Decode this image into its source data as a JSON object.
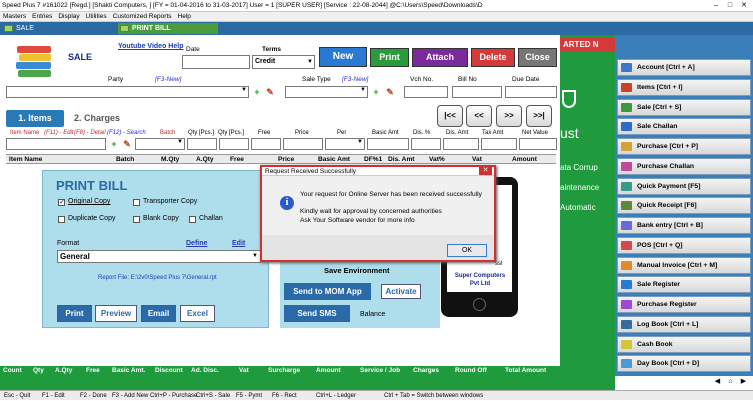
{
  "title": "Speed Plus 7 #161022  [Regd.]  [Shakti Computers, ]  [FY = 01-04-2016 to 31-03-2017]  User = 1 [SUPER USER]  [Service : 22-08-2044]  @C:\\Users\\Speed\\Downloads\\D",
  "menu": [
    "Masters",
    "Entries",
    "Display",
    "Utilities",
    "Customized Reports",
    "Help"
  ],
  "tabs": [
    {
      "label": "SALE"
    },
    {
      "label": "PRINT BILL"
    }
  ],
  "form": {
    "sale_title": "SALE",
    "youtube": "Youtube Video Help",
    "date_label": "Date",
    "terms_label": "Terms",
    "terms_value": "Credit",
    "party_label": "Party",
    "f3_new": "[F3-New]",
    "sale_type_label": "Sale Type",
    "f3_new2": "[F3-New]",
    "vch_no": "Vch No.",
    "bill_no": "Bill No",
    "due_date": "Due Date",
    "btn_new": "New",
    "btn_print": "Print",
    "btn_attach": "Attach",
    "btn_delete": "Delete",
    "btn_close": "Close",
    "tab_items": "1. Items",
    "tab_charges": "2. Charges",
    "nav": [
      "|<<",
      "<<",
      ">>",
      ">>|"
    ],
    "item_help": {
      "name": "Item Name",
      "f11": "(F11) - Edit",
      "f8": "(F8) - Detail",
      "f12": "(F12) - Search",
      "batch": "Batch",
      "qty_pcs": "Qty [Pcs.]",
      "qty_pcs2": "Qty [Pcs.]",
      "free": "Free",
      "price": "Price",
      "per": "Per",
      "basic_amt": "Basic Amt",
      "dis_pct": "Dis. %",
      "dis_amt": "Dis. Amt",
      "tax_amt": "Tax Amt",
      "net_value": "Net Value"
    },
    "grid_headers": [
      "Item Name",
      "Batch",
      "M.Qty",
      "A.Qty",
      "Free",
      "Price",
      "Basic Amt",
      "DF%1",
      "Dis. Amt",
      "Vat%",
      "Vat",
      "Amount"
    ]
  },
  "print_bill": {
    "title": "PRINT BILL",
    "original": "Original Copy",
    "transporter": "Transporter Copy",
    "duplicate": "Duplicate Copy",
    "blank": "Blank Copy",
    "challan": "Challan",
    "format_label": "Format",
    "define": "Define",
    "edit": "Edit",
    "format_value": "General",
    "report_file": "Report File: E:\\2v0\\Speed Plus 7\\General.rpt",
    "btn_print": "Print",
    "btn_preview": "Preview",
    "btn_email": "Email",
    "btn_excel": "Excel"
  },
  "save_env": {
    "title": "Save Environment",
    "send_mom": "Send to MOM App",
    "activate": "Activate",
    "send_sms": "Send SMS",
    "balance": "Balance"
  },
  "phone": {
    "vice": "vice",
    "for": "for",
    "ps": "ps",
    "nfo": "nfo",
    "ssl": "ssl",
    "company": "Super Computers Pvt Ltd"
  },
  "green_panel": {
    "banner": "ARTED N",
    "ust": "ust",
    "corrup": "ata Corrup",
    "maint": "aintenance",
    "auto": "Automatic"
  },
  "dialog": {
    "title": "Request Received Successfully",
    "line1": "Your request for Online Server has been received successfully",
    "line2": "Kindly wait for approval by concerned authorities",
    "line3": "Ask Your Software vendor for more info",
    "ok": "OK"
  },
  "sidebar": [
    {
      "label": "Account [Ctrl + A]",
      "color": "#3d78c4"
    },
    {
      "label": "Items [Ctrl + I]",
      "color": "#c9432a"
    },
    {
      "label": "Sale [Ctrl + S]",
      "color": "#3c9a3c"
    },
    {
      "label": "Sale Challan",
      "color": "#2f6bc2"
    },
    {
      "label": "Purchase [Ctrl + P]",
      "color": "#d4a23a"
    },
    {
      "label": "Purchase Challan",
      "color": "#c04a9a"
    },
    {
      "label": "Quick Payment [F5]",
      "color": "#3a9a8a"
    },
    {
      "label": "Quick Receipt [F6]",
      "color": "#5a8a3a"
    },
    {
      "label": "Bank entry [Ctrl + B]",
      "color": "#6a6ad4"
    },
    {
      "label": "POS [Ctrl + Q]",
      "color": "#d44a4a"
    },
    {
      "label": "Manual Invoice [Ctrl + M]",
      "color": "#e08a2a"
    },
    {
      "label": "Sale Register",
      "color": "#2a7ad4"
    },
    {
      "label": "Purchase Register",
      "color": "#a04ad4"
    },
    {
      "label": "Log Book [Ctrl + L]",
      "color": "#3a6a9a"
    },
    {
      "label": "Cash Book",
      "color": "#d4c43a"
    },
    {
      "label": "Day Book [Ctrl + D]",
      "color": "#4a9ad4"
    }
  ],
  "footer": [
    "Count",
    "Qty",
    "A.Qty",
    "Free",
    "Basic Amt.",
    "Discount",
    "Ad. Disc.",
    "Vat",
    "Surcharge",
    "Amount",
    "Service / Job",
    "Charges",
    "Round Off",
    "Total Amount"
  ],
  "status": [
    "Esc - Quit",
    "F1 - Edit",
    "F2 - Done",
    "F3 - Add New",
    "Ctrl+P - Purchase",
    "Ctrl+S - Sale",
    "F5 - Pymt",
    "F6 - Rect",
    "Ctrl+L - Ledger",
    "Ctrl + Tab = Switch between windows"
  ]
}
